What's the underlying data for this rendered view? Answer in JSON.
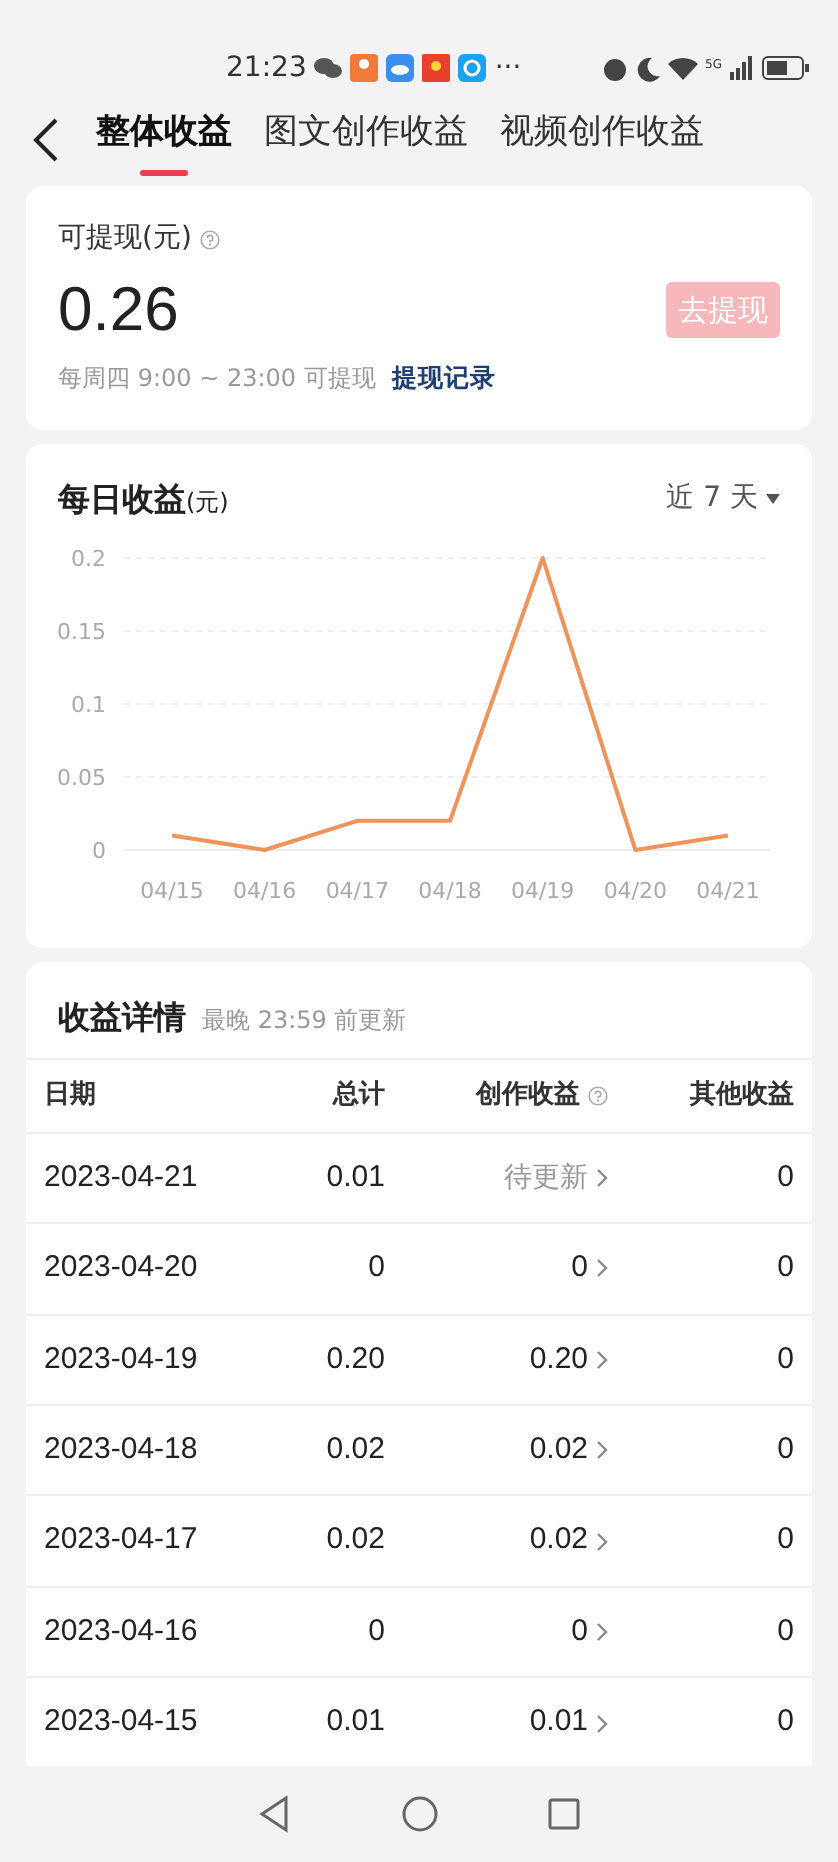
{
  "status_bar": {
    "time": "21:23",
    "more": "···",
    "network": "5G"
  },
  "tabs": [
    {
      "label": "整体收益",
      "selected": true
    },
    {
      "label": "图文创作收益",
      "selected": false
    },
    {
      "label": "视频创作收益",
      "selected": false
    }
  ],
  "balance": {
    "label": "可提现(元)",
    "amount": "0.26",
    "button": {
      "label": "去提现",
      "disabled": true
    },
    "note": "每周四 9:00 ~ 23:00 可提现",
    "link": "提现记录"
  },
  "daily": {
    "title": "每日收益",
    "unit": "(元)",
    "range": "近 7 天",
    "chart_data": {
      "type": "line",
      "categories": [
        "04/15",
        "04/16",
        "04/17",
        "04/18",
        "04/19",
        "04/20",
        "04/21"
      ],
      "series": [
        {
          "color": "#f0935a",
          "values": [
            0.01,
            0,
            0.02,
            0.02,
            0.2,
            0,
            0.01
          ]
        }
      ],
      "grid": true,
      "ylim": [
        0,
        0.2
      ],
      "yticks": [
        0,
        0.05,
        0.1,
        0.15,
        0.2
      ]
    }
  },
  "details": {
    "title": "收益详情",
    "subtitle": "最晚 23:59 前更新",
    "columns": [
      "日期",
      "总计",
      "创作收益",
      "其他收益"
    ],
    "rows": [
      {
        "date": "2023-04-21",
        "total": "0.01",
        "creation": "待更新",
        "pending": true,
        "other": "0"
      },
      {
        "date": "2023-04-20",
        "total": "0",
        "creation": "0",
        "pending": false,
        "other": "0"
      },
      {
        "date": "2023-04-19",
        "total": "0.20",
        "creation": "0.20",
        "pending": false,
        "other": "0"
      },
      {
        "date": "2023-04-18",
        "total": "0.02",
        "creation": "0.02",
        "pending": false,
        "other": "0"
      },
      {
        "date": "2023-04-17",
        "total": "0.02",
        "creation": "0.02",
        "pending": false,
        "other": "0"
      },
      {
        "date": "2023-04-16",
        "total": "0",
        "creation": "0",
        "pending": false,
        "other": "0"
      },
      {
        "date": "2023-04-15",
        "total": "0.01",
        "creation": "0.01",
        "pending": false,
        "other": "0"
      }
    ]
  }
}
